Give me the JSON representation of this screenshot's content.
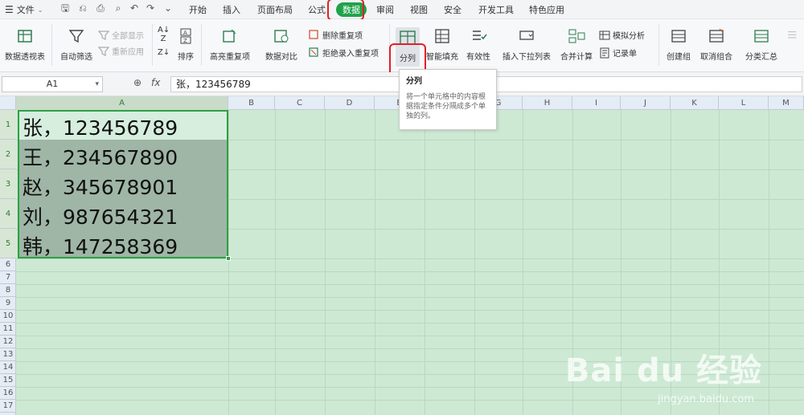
{
  "menubar": {
    "file_label": "文件",
    "tabs": [
      "开始",
      "插入",
      "页面布局",
      "公式",
      "数据",
      "审阅",
      "视图",
      "安全",
      "开发工具",
      "特色应用"
    ],
    "active_tab": "数据"
  },
  "ribbon": {
    "pivot": "数据透视表",
    "autofilter": "自动筛选",
    "show_all": "全部显示",
    "reapply": "重新应用",
    "sort": "排序",
    "highlight_dup": "高亮重复项",
    "compare": "数据对比",
    "remove_dup": "删除重复项",
    "reject_dup": "拒绝录入重复项",
    "split_column": "分列",
    "smart_fill": "智能填充",
    "validity": "有效性",
    "insert_dropdown": "插入下拉列表",
    "merge_calc": "合并计算",
    "simulate": "模拟分析",
    "record": "记录单",
    "create_group": "创建组",
    "ungroup": "取消组合",
    "subtotal": "分类汇总"
  },
  "tooltip": {
    "title": "分列",
    "body": "将一个单元格中的内容根据指定条件分隔成多个单独的列。"
  },
  "formula_bar": {
    "cell_ref": "A1",
    "fx_label": "fx",
    "content": "张，123456789"
  },
  "sheet": {
    "columns": [
      "A",
      "B",
      "C",
      "D",
      "E",
      "F",
      "G",
      "H",
      "I",
      "J",
      "K",
      "L",
      "M"
    ],
    "rows": [
      "1",
      "2",
      "3",
      "4",
      "5",
      "6",
      "7",
      "8",
      "9",
      "10",
      "11",
      "12",
      "13",
      "14",
      "15",
      "16",
      "17"
    ],
    "cells": [
      "张，123456789",
      "王，234567890",
      "赵，345678901",
      "刘，987654321",
      "韩，147258369"
    ]
  },
  "watermark": {
    "brand": "Bai du 经验",
    "url": "jingyan.baidu.com"
  },
  "colors": {
    "active_tab": "#1fa34a",
    "highlight_box": "#e0202a",
    "selection_border": "#2ea043",
    "grid_background": "#cde9d4"
  }
}
